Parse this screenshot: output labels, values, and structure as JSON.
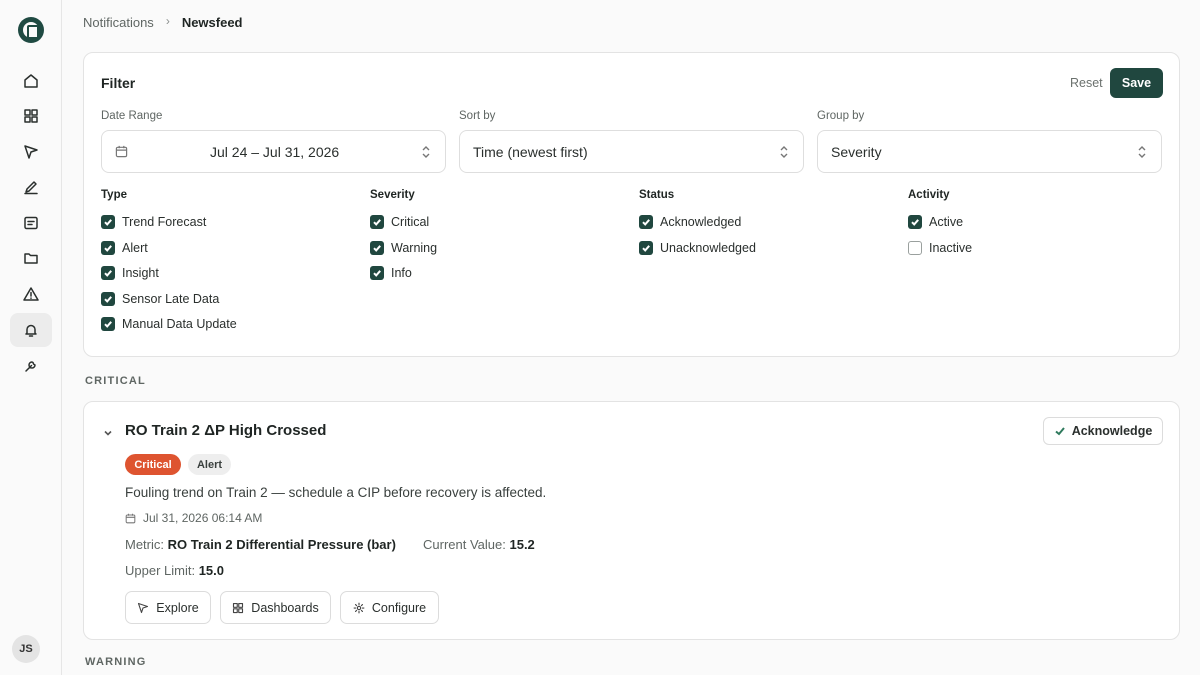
{
  "breadcrumb": {
    "parent": "Notifications",
    "current": "Newsfeed"
  },
  "sidebar": {
    "items": [
      {
        "icon": "home-icon"
      },
      {
        "icon": "grid-icon"
      },
      {
        "icon": "cursor-icon"
      },
      {
        "icon": "pen-icon"
      },
      {
        "icon": "message-icon"
      },
      {
        "icon": "folder-icon"
      },
      {
        "icon": "warning-icon"
      },
      {
        "icon": "bell-icon",
        "active": true
      },
      {
        "icon": "wrench-icon"
      }
    ],
    "avatar_initials": "JS"
  },
  "filter": {
    "title": "Filter",
    "reset_label": "Reset",
    "save_label": "Save",
    "date_range": {
      "label": "Date Range",
      "value": "Jul 24 – Jul 31, 2026"
    },
    "sort_by": {
      "label": "Sort by",
      "value": "Time (newest first)"
    },
    "group_by": {
      "label": "Group by",
      "value": "Severity"
    },
    "groups": {
      "type": {
        "title": "Type",
        "options": [
          {
            "label": "Trend Forecast",
            "checked": true
          },
          {
            "label": "Alert",
            "checked": true
          },
          {
            "label": "Insight",
            "checked": true
          },
          {
            "label": "Sensor Late Data",
            "checked": true
          },
          {
            "label": "Manual Data Update",
            "checked": true
          }
        ]
      },
      "severity": {
        "title": "Severity",
        "options": [
          {
            "label": "Critical",
            "checked": true
          },
          {
            "label": "Warning",
            "checked": true
          },
          {
            "label": "Info",
            "checked": true
          }
        ]
      },
      "status": {
        "title": "Status",
        "options": [
          {
            "label": "Acknowledged",
            "checked": true
          },
          {
            "label": "Unacknowledged",
            "checked": true
          }
        ]
      },
      "activity": {
        "title": "Activity",
        "options": [
          {
            "label": "Active",
            "checked": true
          },
          {
            "label": "Inactive",
            "checked": false
          }
        ]
      }
    }
  },
  "sections": {
    "critical_label": "CRITICAL",
    "warning_label": "WARNING"
  },
  "alert": {
    "title": "RO Train 2 ΔP High Crossed",
    "acknowledge_label": "Acknowledge",
    "severity_badge": "Critical",
    "type_badge": "Alert",
    "description": "Fouling trend on Train 2 — schedule a CIP before recovery is affected.",
    "timestamp": "Jul 31, 2026 06:14 AM",
    "metric_label": "Metric:",
    "metric_value": "RO Train 2 Differential Pressure (bar)",
    "current_value_label": "Current Value:",
    "current_value": "15.2",
    "upper_limit_label": "Upper Limit:",
    "upper_limit": "15.0",
    "actions": {
      "explore": "Explore",
      "dashboards": "Dashboards",
      "configure": "Configure"
    }
  },
  "colors": {
    "primary": "#20473f",
    "critical": "#de5430"
  }
}
